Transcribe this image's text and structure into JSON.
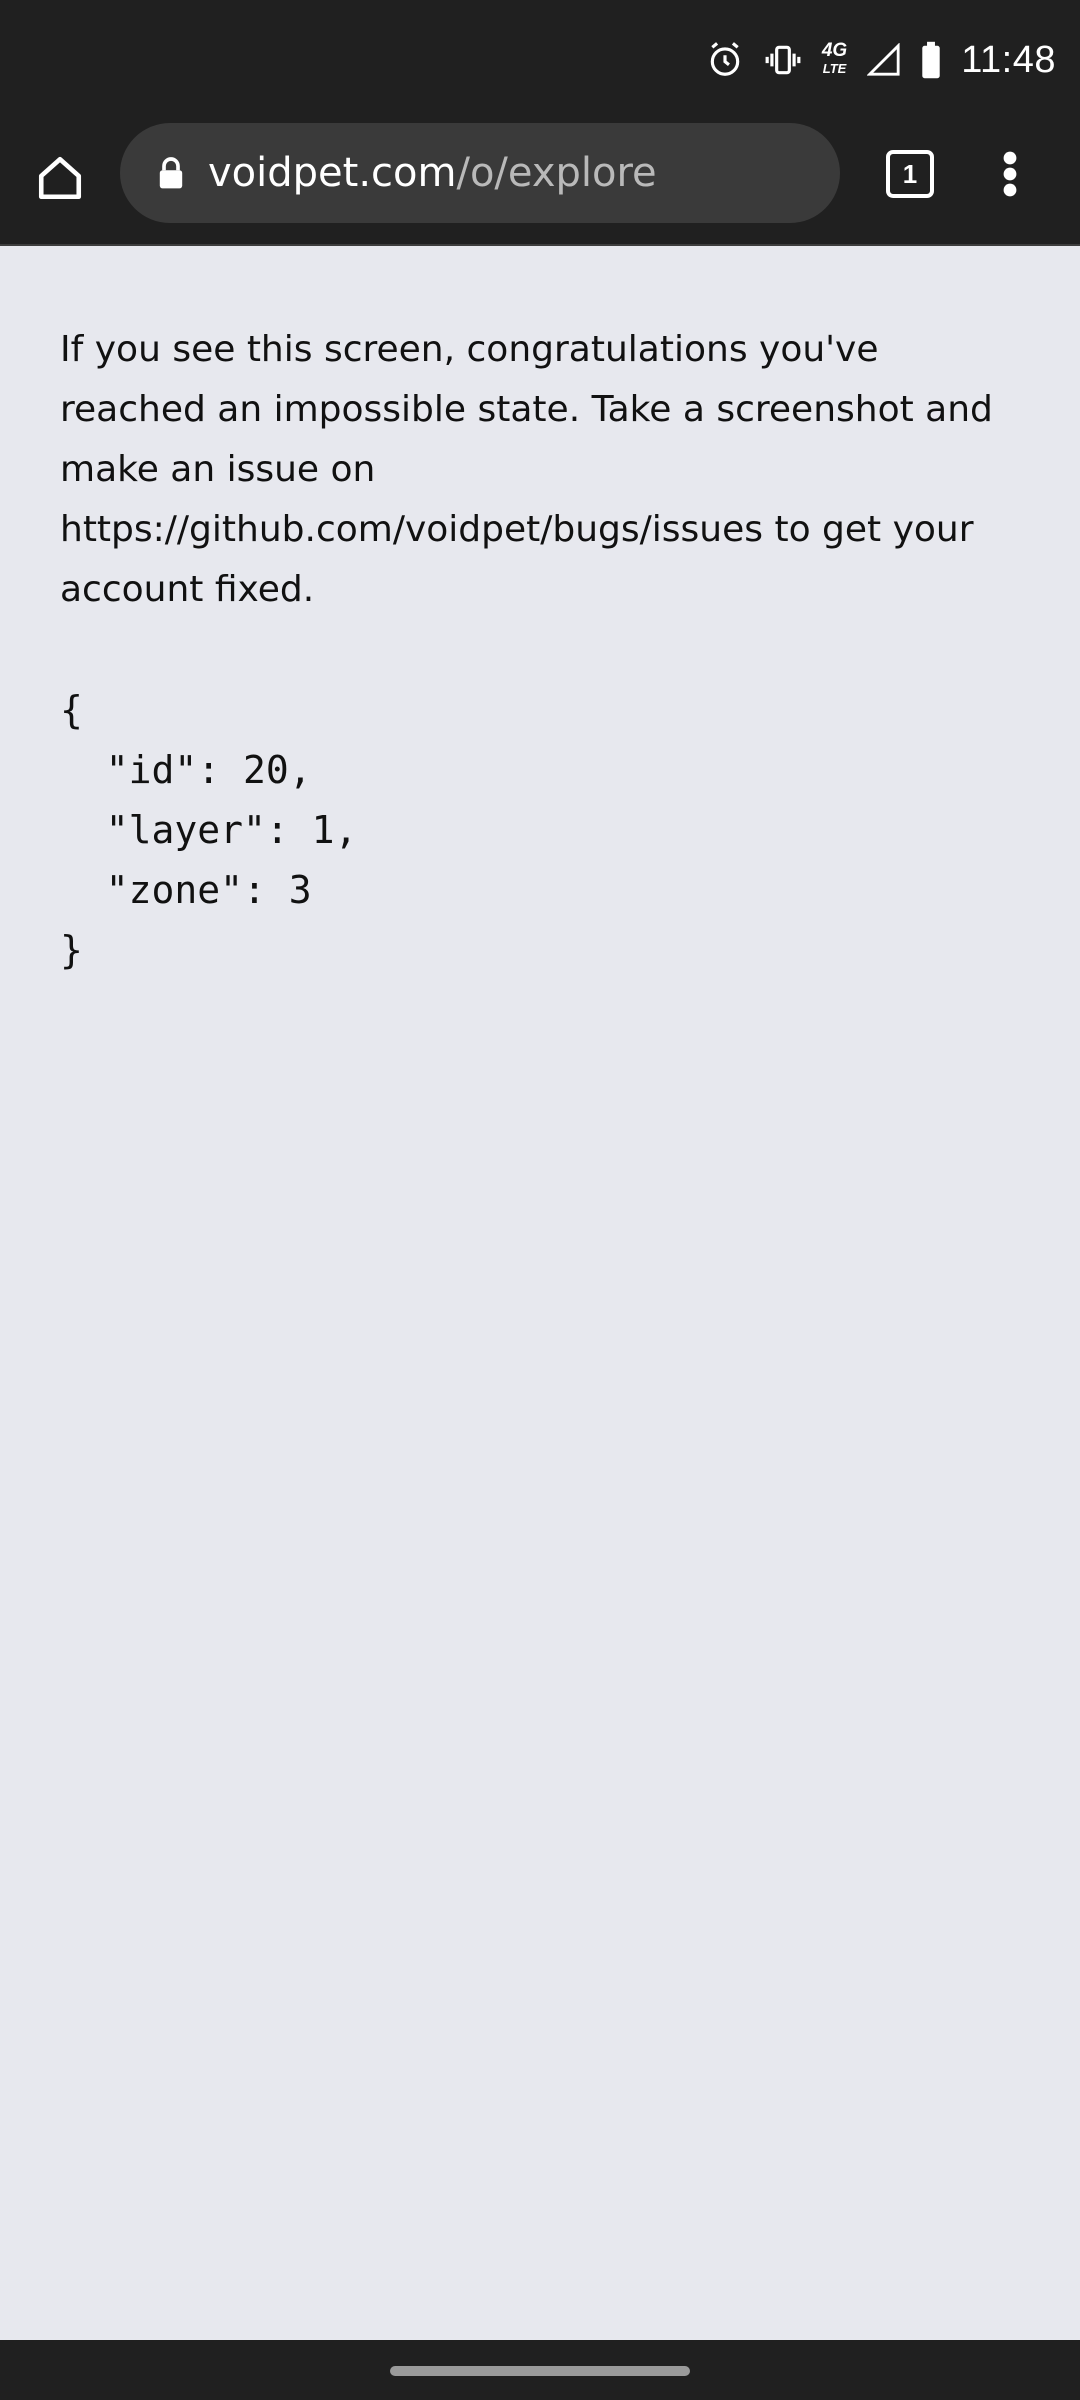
{
  "status_bar": {
    "time": "11:48",
    "network_label": "4G",
    "network_sublabel": "LTE",
    "icons": [
      "alarm-icon",
      "vibrate-icon",
      "network-4g-lte-icon",
      "signal-icon",
      "battery-icon"
    ]
  },
  "browser": {
    "url_domain": "voidpet.com",
    "url_path": "/o/explore",
    "tab_count": "1",
    "icons": [
      "home-icon",
      "lock-icon",
      "tab-switcher-icon",
      "more-vert-icon"
    ]
  },
  "page": {
    "message": "If you see this screen, congratulations you've reached an impossible state. Take a screenshot and make an issue on https://github.com/voidpet/bugs/issues to get your account fixed.",
    "json_text": "{\n  \"id\": 20,\n  \"layer\": 1,\n  \"zone\": 3\n}"
  },
  "colors": {
    "system_bar": "#202020",
    "url_bar": "#3a3a3a",
    "page_background": "#e7e8ee",
    "text": "#111111",
    "url_path": "#b9b9b9"
  }
}
